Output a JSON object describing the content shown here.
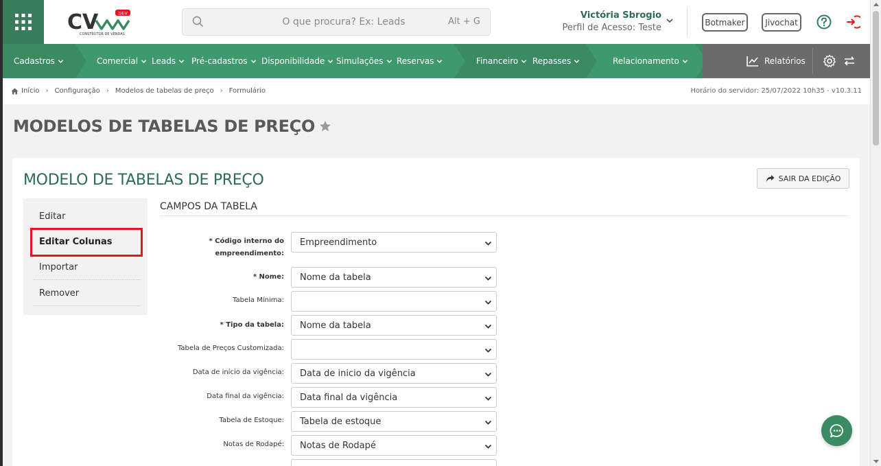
{
  "header": {
    "logo_text": "CV",
    "logo_badge": "DEV",
    "logo_subtitle": "CONSTRUTOR DE VENDAS",
    "search_placeholder": "O que procura? Ex: Leads",
    "search_shortcut": "Alt + G",
    "user_name": "Victória Sbrogio",
    "user_profile": "Perfil de Acesso: Teste",
    "botmaker_label": "Botmaker",
    "jivochat_label": "Jivochat"
  },
  "nav": {
    "items": [
      {
        "label": "Cadastros"
      },
      {
        "label": "Comercial"
      },
      {
        "label": "Leads"
      },
      {
        "label": "Pré-cadastros"
      },
      {
        "label": "Disponibilidade"
      },
      {
        "label": "Simulações"
      },
      {
        "label": "Reservas"
      },
      {
        "label": "Financeiro"
      },
      {
        "label": "Repasses"
      },
      {
        "label": "Relacionamento"
      }
    ],
    "reports_label": "Relatórios"
  },
  "breadcrumb": {
    "items": [
      "Início",
      "Configuração",
      "Modelos de tabelas de preço",
      "Formulário"
    ],
    "server_time": "Horário do servidor: 25/07/2022 10h35 - v10.3.11"
  },
  "page": {
    "title": "MODELOS DE TABELAS DE PREÇO",
    "card_title": "MODELO DE TABELAS DE PREÇO",
    "exit_label": "SAIR DA EDIÇÃO",
    "section_title": "CAMPOS DA TABELA"
  },
  "side_menu": [
    "Editar",
    "Editar Colunas",
    "Importar",
    "Remover"
  ],
  "fields": [
    {
      "label": "* Código interno do empreendimento:",
      "value": "Empreendimento"
    },
    {
      "label": "* Nome:",
      "value": "Nome da tabela"
    },
    {
      "label": "Tabela Mínima:",
      "value": ""
    },
    {
      "label": "* Tipo da tabela:",
      "value": "Nome da tabela"
    },
    {
      "label": "Tabela de Preços Customizada:",
      "value": ""
    },
    {
      "label": "Data de início da vigência:",
      "value": "Data de inicio da vigência"
    },
    {
      "label": "Data final da vigência:",
      "value": "Data final da vigência"
    },
    {
      "label": "Tabela de Estoque:",
      "value": "Tabela de estoque"
    },
    {
      "label": "Notas de Rodapé:",
      "value": "Notas de Rodapé"
    }
  ],
  "colors": {
    "brand_green": "#3a8a62",
    "highlight_red": "#e3161b",
    "reports_bar": "#6b6b6b"
  }
}
